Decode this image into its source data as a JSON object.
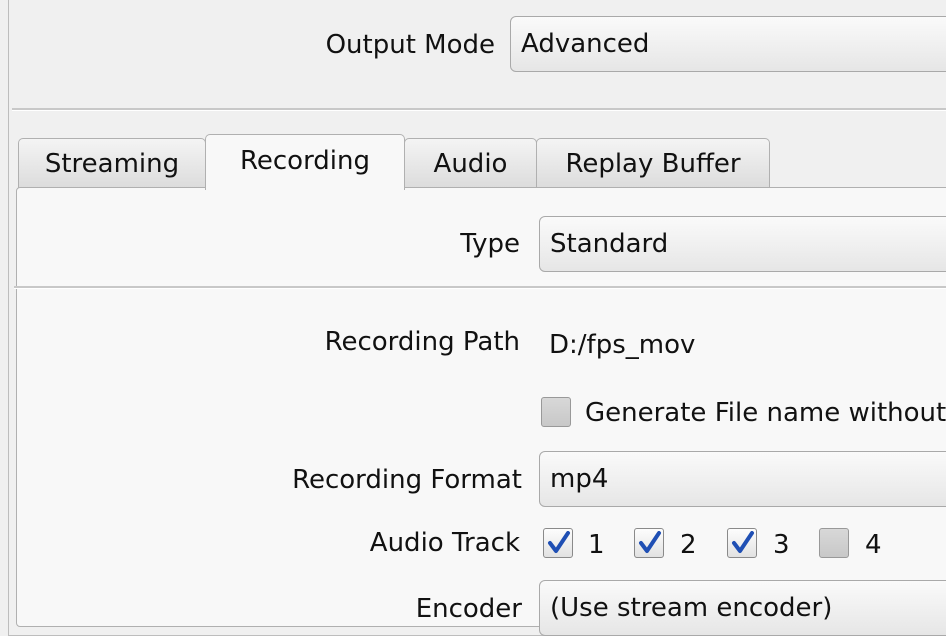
{
  "output_mode": {
    "label": "Output Mode",
    "value": "Advanced"
  },
  "tabs": [
    {
      "label": "Streaming",
      "active": false
    },
    {
      "label": "Recording",
      "active": true
    },
    {
      "label": "Audio",
      "active": false
    },
    {
      "label": "Replay Buffer",
      "active": false
    }
  ],
  "recording": {
    "type_label": "Type",
    "type_value": "Standard",
    "path_label": "Recording Path",
    "path_value": "D:/fps_mov",
    "gen_filename_label": "Generate File name without",
    "gen_filename_checked": false,
    "format_label": "Recording Format",
    "format_value": "mp4",
    "audio_track_label": "Audio Track",
    "audio_tracks": [
      {
        "label": "1",
        "checked": true
      },
      {
        "label": "2",
        "checked": true
      },
      {
        "label": "3",
        "checked": true
      },
      {
        "label": "4",
        "checked": false
      }
    ],
    "encoder_label": "Encoder",
    "encoder_value": "(Use stream encoder)"
  },
  "colors": {
    "check_mark": "#1f4fb4"
  },
  "icons": {
    "check": "check-icon"
  }
}
